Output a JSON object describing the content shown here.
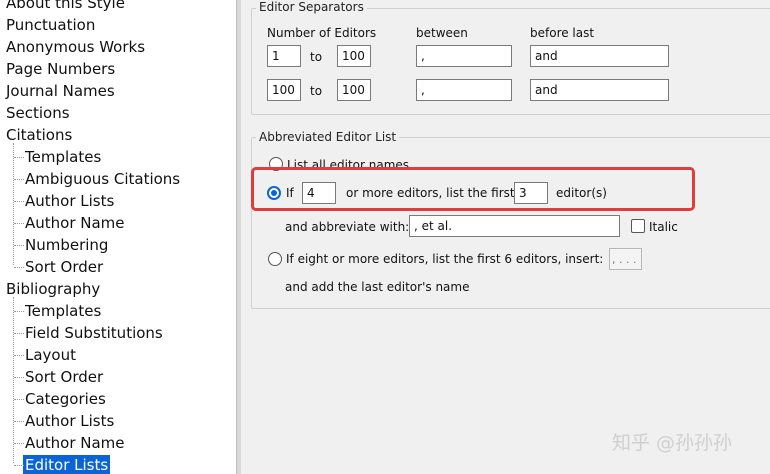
{
  "tree": {
    "items": [
      {
        "label": "About this Style",
        "level": 0,
        "selected": false
      },
      {
        "label": "Punctuation",
        "level": 0,
        "selected": false
      },
      {
        "label": "Anonymous Works",
        "level": 0,
        "selected": false
      },
      {
        "label": "Page Numbers",
        "level": 0,
        "selected": false
      },
      {
        "label": "Journal Names",
        "level": 0,
        "selected": false
      },
      {
        "label": "Sections",
        "level": 0,
        "selected": false
      },
      {
        "label": "Citations",
        "level": 0,
        "selected": false
      },
      {
        "label": "Templates",
        "level": 1,
        "selected": false
      },
      {
        "label": "Ambiguous Citations",
        "level": 1,
        "selected": false
      },
      {
        "label": "Author Lists",
        "level": 1,
        "selected": false
      },
      {
        "label": "Author Name",
        "level": 1,
        "selected": false
      },
      {
        "label": "Numbering",
        "level": 1,
        "selected": false
      },
      {
        "label": "Sort Order",
        "level": 1,
        "selected": false
      },
      {
        "label": "Bibliography",
        "level": 0,
        "selected": false
      },
      {
        "label": "Templates",
        "level": 1,
        "selected": false
      },
      {
        "label": "Field Substitutions",
        "level": 1,
        "selected": false
      },
      {
        "label": "Layout",
        "level": 1,
        "selected": false
      },
      {
        "label": "Sort Order",
        "level": 1,
        "selected": false
      },
      {
        "label": "Categories",
        "level": 1,
        "selected": false
      },
      {
        "label": "Author Lists",
        "level": 1,
        "selected": false
      },
      {
        "label": "Author Name",
        "level": 1,
        "selected": false
      },
      {
        "label": "Editor Lists",
        "level": 1,
        "selected": true
      }
    ]
  },
  "separators": {
    "title": "Editor Separators",
    "col_number": "Number of Editors",
    "col_between": "between",
    "col_before_last": "before last",
    "to_label": "to",
    "rows": [
      {
        "from": "1",
        "to": "100",
        "between": ",",
        "before_last": "and"
      },
      {
        "from": "100",
        "to": "100",
        "between": ",",
        "before_last": "and"
      }
    ]
  },
  "abbrev": {
    "title": "Abbreviated Editor List",
    "opt_list_all": "List all editor names",
    "opt_if_prefix": "If",
    "if_count": "4",
    "opt_if_middle": "or more editors, list the first",
    "first_count": "3",
    "opt_if_suffix": "editor(s)",
    "abbreviate_label": "and abbreviate with:",
    "abbreviate_value": ", et al.",
    "italic_label": "Italic",
    "opt_eight": "If eight or more editors, list the first 6 editors, insert:",
    "eight_value": ", . . .",
    "last_name_label": "and add the last editor's name",
    "selected_option": "if"
  },
  "watermark": "知乎 @孙孙孙",
  "colors": {
    "selection": "#0a64d8",
    "highlight": "#e23b3b",
    "panel_bg": "#f0f0f0"
  }
}
